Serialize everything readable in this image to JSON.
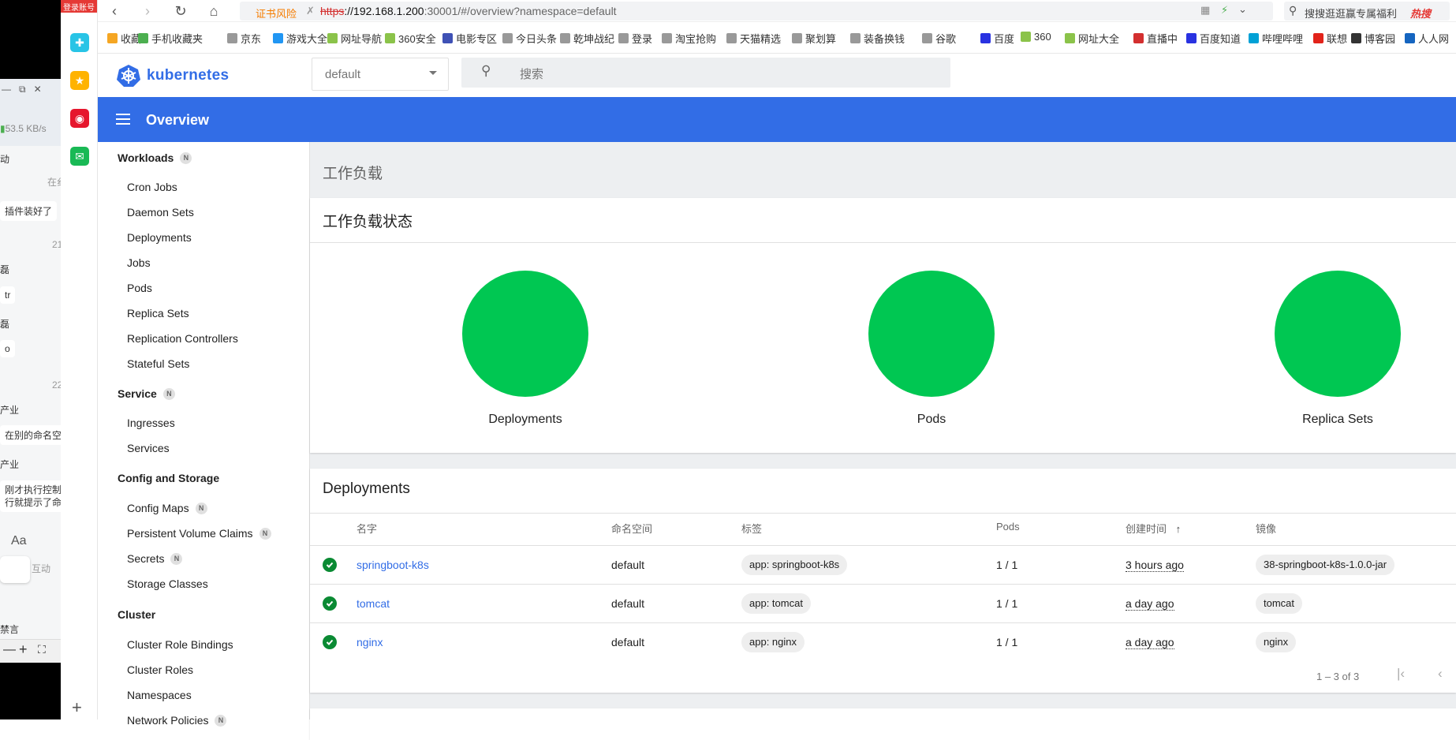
{
  "left_panel": {
    "badge": "登录账号",
    "speed": "53.5 KB/s",
    "frag1": "动",
    "frag2": "在纟",
    "bubble1": "插件装好了",
    "num1": "21",
    "frag3": "磊",
    "bubble2": "tr",
    "frag4": "磊",
    "bubble3": "o",
    "num2": "22",
    "frag5": "产业",
    "bubble4": "在别的命名空间",
    "frag6": "产业",
    "bubble5a": "刚才执行控制台",
    "bubble5b": "行就提示了命名",
    "interact": "互动",
    "mute": "禁言"
  },
  "browser": {
    "address_warning": "证书风险",
    "url_scheme": "https",
    "url_host": "://192.168.1.200",
    "url_rest": ":30001/#/overview?namespace=default",
    "search_hint": "搜搜逛逛赢专属福利",
    "hot": "热搜",
    "bookmarks": [
      {
        "label": "收藏",
        "color": "#f5a623"
      },
      {
        "label": "手机收藏夹",
        "color": "#4caf50"
      },
      {
        "label": "京东",
        "color": "#999"
      },
      {
        "label": "游戏大全",
        "color": "#2196f3"
      },
      {
        "label": "网址导航",
        "color": "#8bc34a"
      },
      {
        "label": "360安全",
        "color": "#8bc34a"
      },
      {
        "label": "电影专区",
        "color": "#3f51b5"
      },
      {
        "label": "今日头条",
        "color": "#999"
      },
      {
        "label": "乾坤战纪",
        "color": "#999"
      },
      {
        "label": "登录",
        "color": "#999"
      },
      {
        "label": "淘宝抢购",
        "color": "#999"
      },
      {
        "label": "天猫精选",
        "color": "#999"
      },
      {
        "label": "聚划算",
        "color": "#999"
      },
      {
        "label": "装备换钱",
        "color": "#999"
      },
      {
        "label": "谷歌",
        "color": "#999"
      },
      {
        "label": "百度",
        "color": "#2932e1"
      },
      {
        "label": "360",
        "color": "#8bc34a"
      },
      {
        "label": "网址大全",
        "color": "#8bc34a"
      },
      {
        "label": "直播中",
        "color": "#d32f2f"
      },
      {
        "label": "百度知道",
        "color": "#2932e1"
      },
      {
        "label": "哔哩哔哩",
        "color": "#00a1d6"
      },
      {
        "label": "联想",
        "color": "#e2231a"
      },
      {
        "label": "博客园",
        "color": "#333"
      },
      {
        "label": "人人网",
        "color": "#1565c0"
      }
    ]
  },
  "k8s": {
    "logo_text": "kubernetes",
    "namespace": "default",
    "search_placeholder": "搜索",
    "toolbar_title": "Overview",
    "accent": "#326de6",
    "success": "#00c752",
    "nav": {
      "workloads": "Workloads",
      "workload_items": [
        "Cron Jobs",
        "Daemon Sets",
        "Deployments",
        "Jobs",
        "Pods",
        "Replica Sets",
        "Replication Controllers",
        "Stateful Sets"
      ],
      "service": "Service",
      "service_items": [
        "Ingresses",
        "Services"
      ],
      "config": "Config and Storage",
      "config_items": [
        "Config Maps",
        "Persistent Volume Claims",
        "Secrets",
        "Storage Classes"
      ],
      "cluster": "Cluster",
      "cluster_items": [
        "Cluster Role Bindings",
        "Cluster Roles",
        "Namespaces",
        "Network Policies"
      ],
      "badge": "N"
    },
    "main": {
      "section_title": "工作负载",
      "status_card_title": "工作负载状态",
      "status": [
        {
          "label": "Deployments",
          "running_fraction": 1.0
        },
        {
          "label": "Pods",
          "running_fraction": 1.0
        },
        {
          "label": "Replica Sets",
          "running_fraction": 1.0
        }
      ],
      "deployments_title": "Deployments",
      "columns": [
        "名字",
        "命名空间",
        "标签",
        "Pods",
        "创建时间",
        "镜像"
      ],
      "rows": [
        {
          "name": "springboot-k8s",
          "namespace": "default",
          "label": "app: springboot-k8s",
          "pods": "1 / 1",
          "created": "3 hours ago",
          "image": "38-springboot-k8s-1.0.0-jar"
        },
        {
          "name": "tomcat",
          "namespace": "default",
          "label": "app: tomcat",
          "pods": "1 / 1",
          "created": "a day ago",
          "image": "tomcat"
        },
        {
          "name": "nginx",
          "namespace": "default",
          "label": "app: nginx",
          "pods": "1 / 1",
          "created": "a day ago",
          "image": "nginx"
        }
      ],
      "pagination": "1 – 3 of 3"
    }
  }
}
